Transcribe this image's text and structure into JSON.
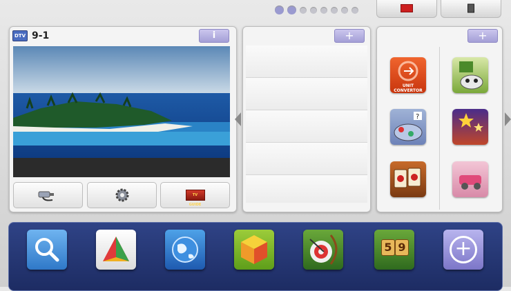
{
  "pager": {
    "total": 8,
    "active": [
      0,
      1
    ]
  },
  "top_buttons": [
    {
      "name": "top-button-red",
      "color": "#cc1f1f"
    },
    {
      "name": "top-button-dark",
      "color": "#555555"
    }
  ],
  "tv_panel": {
    "channel": "9-1",
    "tv_icon_text": "DTV",
    "info_label": "i",
    "controls": [
      {
        "name": "input-source-button",
        "icon": "cable-plug-icon"
      },
      {
        "name": "settings-button",
        "icon": "gear-icon"
      },
      {
        "name": "tv-guide-button",
        "icon": "tv-guide-icon",
        "text": "TV GUIDE"
      }
    ]
  },
  "middle_panel": {
    "add_label": "+",
    "rows": 5
  },
  "apps_panel": {
    "add_label": "+",
    "apps": [
      {
        "name": "unit-convertor-app",
        "text": "UNIT CONVERTOR"
      },
      {
        "name": "animal-game-app"
      },
      {
        "name": "planet-game-app"
      },
      {
        "name": "stars-game-app"
      },
      {
        "name": "mahjong-app"
      },
      {
        "name": "pink-car-app"
      }
    ]
  },
  "dock": [
    {
      "name": "search-app",
      "icon": "search-icon"
    },
    {
      "name": "triangle-app",
      "icon": "triangle-logo-icon"
    },
    {
      "name": "globe-app",
      "icon": "globe-icon"
    },
    {
      "name": "cube-app",
      "icon": "cube-icon"
    },
    {
      "name": "archery-game-app",
      "icon": "archery-icon"
    },
    {
      "name": "number-puzzle-app",
      "icon": "number-tiles-icon",
      "tiles": [
        "5",
        "9"
      ]
    },
    {
      "name": "add-app-button",
      "icon": "plus-icon",
      "label": "+"
    }
  ]
}
